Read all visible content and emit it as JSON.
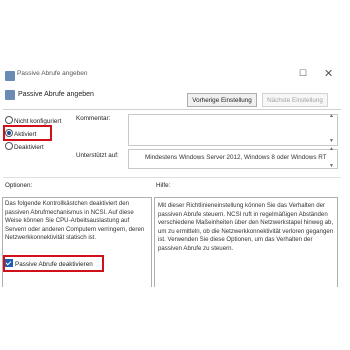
{
  "window": {
    "title": "Passive Abrufe angeben",
    "maximize_glyph": "☐",
    "close_glyph": "✕"
  },
  "header": {
    "title": "Passive Abrufe angeben",
    "prev_button": "Vorherige Einstellung",
    "next_button": "Nächste Einstellung"
  },
  "state": {
    "options": [
      {
        "label": "Nicht konfiguriert",
        "selected": false
      },
      {
        "label": "Aktiviert",
        "selected": true
      },
      {
        "label": "Deaktiviert",
        "selected": false
      }
    ]
  },
  "form": {
    "comment_label": "Kommentar:",
    "comment_value": "",
    "supported_label": "Unterstützt auf:",
    "supported_value": "Mindestens Windows Server 2012, Windows 8 oder Windows RT"
  },
  "sections": {
    "options_label": "Optionen:",
    "help_label": "Hilfe:"
  },
  "options_panel": {
    "description": "Das folgende Kontrollkästchen deaktiviert den passiven Abrufmechanismus in NCSI. Auf diese Weise können Sie CPU-Arbeitsauslastung auf Servern oder anderen Computern verringern, deren Netzwerkkonnektivität statisch ist.",
    "checkbox_label": "Passive Abrufe deaktivieren",
    "checkbox_checked": true
  },
  "help_panel": {
    "text": "Mit dieser Richtlinieneinstellung können Sie das Verhalten der passiven Abrufe steuern. NCSI ruft in regelmäßigen Abständen verschiedene Maßeinheiten über den Netzwerkstapel hinweg ab, um zu ermitteln, ob die Netzwerkkonnektivität verloren gegangen ist. Verwenden Sie diese Optionen, um das Verhalten der passiven Abrufe zu steuern."
  },
  "colors": {
    "highlight": "#d0111a",
    "accent": "#1a5fb4"
  }
}
